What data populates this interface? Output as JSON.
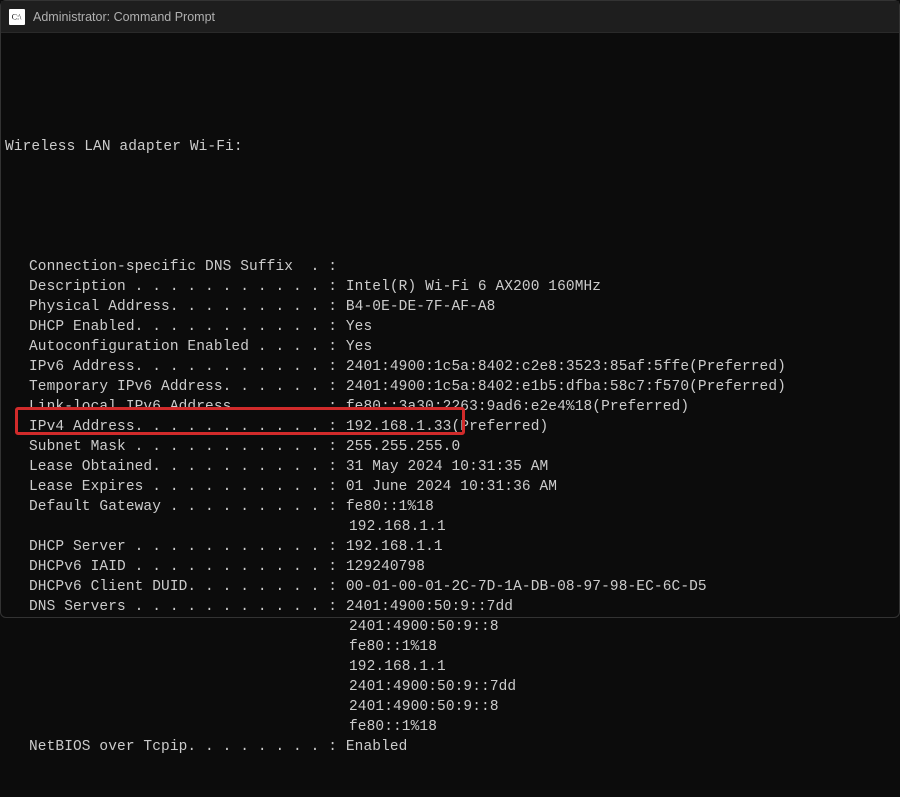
{
  "titlebar": {
    "title": "Administrator: Command Prompt"
  },
  "header": "Wireless LAN adapter Wi-Fi:",
  "rows": [
    {
      "label": "Connection-specific DNS Suffix  . :",
      "value": ""
    },
    {
      "label": "Description . . . . . . . . . . . :",
      "value": " Intel(R) Wi-Fi 6 AX200 160MHz"
    },
    {
      "label": "Physical Address. . . . . . . . . :",
      "value": " B4-0E-DE-7F-AF-A8"
    },
    {
      "label": "DHCP Enabled. . . . . . . . . . . :",
      "value": " Yes"
    },
    {
      "label": "Autoconfiguration Enabled . . . . :",
      "value": " Yes"
    },
    {
      "label": "IPv6 Address. . . . . . . . . . . :",
      "value": " 2401:4900:1c5a:8402:c2e8:3523:85af:5ffe(Preferred)"
    },
    {
      "label": "Temporary IPv6 Address. . . . . . :",
      "value": " 2401:4900:1c5a:8402:e1b5:dfba:58c7:f570(Preferred)"
    },
    {
      "label": "Link-local IPv6 Address . . . . . :",
      "value": " fe80::3a30:2263:9ad6:e2e4%18(Preferred)"
    },
    {
      "label": "IPv4 Address. . . . . . . . . . . :",
      "value": " 192.168.1.33(Preferred)"
    },
    {
      "label": "Subnet Mask . . . . . . . . . . . :",
      "value": " 255.255.255.0"
    },
    {
      "label": "Lease Obtained. . . . . . . . . . :",
      "value": " 31 May 2024 10:31:35 AM"
    },
    {
      "label": "Lease Expires . . . . . . . . . . :",
      "value": " 01 June 2024 10:31:36 AM"
    },
    {
      "label": "Default Gateway . . . . . . . . . :",
      "value": " fe80::1%18"
    },
    {
      "label": "",
      "value": "192.168.1.1",
      "cont": true
    },
    {
      "label": "DHCP Server . . . . . . . . . . . :",
      "value": " 192.168.1.1",
      "hl": true
    },
    {
      "label": "DHCPv6 IAID . . . . . . . . . . . :",
      "value": " 129240798"
    },
    {
      "label": "DHCPv6 Client DUID. . . . . . . . :",
      "value": " 00-01-00-01-2C-7D-1A-DB-08-97-98-EC-6C-D5"
    },
    {
      "label": "DNS Servers . . . . . . . . . . . :",
      "value": " 2401:4900:50:9::7dd"
    },
    {
      "label": "",
      "value": "2401:4900:50:9::8",
      "cont": true
    },
    {
      "label": "",
      "value": "fe80::1%18",
      "cont": true
    },
    {
      "label": "",
      "value": "192.168.1.1",
      "cont": true
    },
    {
      "label": "",
      "value": "2401:4900:50:9::7dd",
      "cont": true
    },
    {
      "label": "",
      "value": "2401:4900:50:9::8",
      "cont": true
    },
    {
      "label": "",
      "value": "fe80::1%18",
      "cont": true
    },
    {
      "label": "NetBIOS over Tcpip. . . . . . . . :",
      "value": " Enabled"
    }
  ]
}
